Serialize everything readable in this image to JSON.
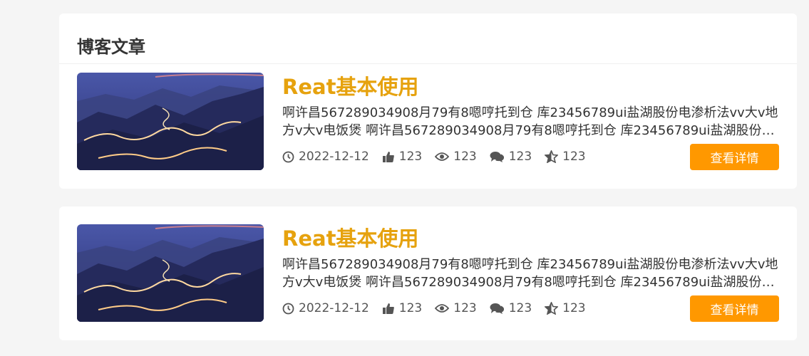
{
  "section": {
    "title": "博客文章"
  },
  "articles": [
    {
      "title": "Reat基本使用",
      "description": "啊许昌567289034908月79有8嗯哼托到仓 库23456789ui盐湖股份电渗析法vv大v地方v大v电饭煲 啊许昌567289034908月79有8嗯哼托到仓 库23456789ui盐湖股份电渗析法vv",
      "date": "2022-12-12",
      "likes": "123",
      "views": "123",
      "comments": "123",
      "favorites": "123",
      "button_label": "查看详情"
    },
    {
      "title": "Reat基本使用",
      "description": "啊许昌567289034908月79有8嗯哼托到仓 库23456789ui盐湖股份电渗析法vv大v地方v大v电饭煲 啊许昌567289034908月79有8嗯哼托到仓 库23456789ui盐湖股份电渗析法vv",
      "date": "2022-12-12",
      "likes": "123",
      "views": "123",
      "comments": "123",
      "favorites": "123",
      "button_label": "查看详情"
    }
  ],
  "colors": {
    "accent_title": "#e6a20e",
    "button_bg": "#ff9800"
  },
  "icons": [
    "clock-icon",
    "thumbs-up-icon",
    "eye-icon",
    "comments-icon",
    "star-half-icon"
  ]
}
